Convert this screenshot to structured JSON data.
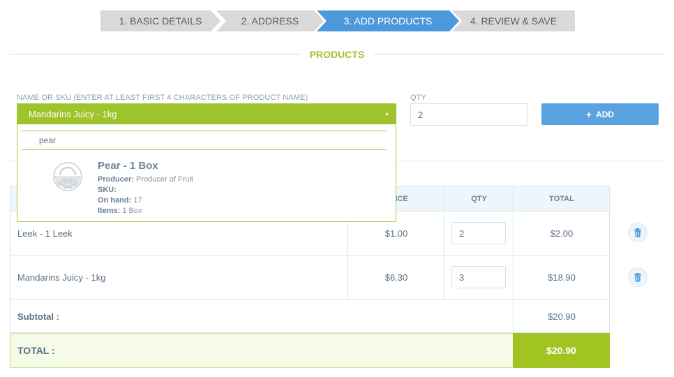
{
  "steps": [
    {
      "label": "1. BASIC DETAILS"
    },
    {
      "label": "2. ADDRESS"
    },
    {
      "label": "3. ADD PRODUCTS"
    },
    {
      "label": "4. REVIEW & SAVE"
    }
  ],
  "active_step": 3,
  "section": {
    "title": "PRODUCTS"
  },
  "form": {
    "name_label": "NAME OR SKU (ENTER AT LEAST FIRST 4 CHARACTERS OF PRODUCT NAME)",
    "qty_label": "QTY",
    "qty_value": "2",
    "add_label": "ADD"
  },
  "dropdown": {
    "selected": "Mandarins Juicy - 1kg",
    "search_value": "pear",
    "result": {
      "title": "Pear - 1 Box",
      "producer_label": "Producer:",
      "producer": "Producer of Fruit",
      "sku_label": "SKU:",
      "sku": "",
      "on_hand_label": "On hand:",
      "on_hand": "17",
      "items_label": "Items:",
      "items": "1 Box"
    }
  },
  "table": {
    "headers": {
      "price": "PRICE",
      "qty": "QTY",
      "total": "TOTAL"
    },
    "rows": [
      {
        "name": "Leek - 1 Leek",
        "price": "$1.00",
        "qty": "2",
        "total": "$2.00"
      },
      {
        "name": "Mandarins Juicy - 1kg",
        "price": "$6.30",
        "qty": "3",
        "total": "$18.90"
      }
    ],
    "subtotal_label": "Subtotal :",
    "subtotal": "$20.90",
    "total_label": "TOTAL :",
    "total": "$20.90"
  },
  "colors": {
    "accent_green": "#9fc32a",
    "active_step_blue": "#4b98dc",
    "button_blue": "#5aa3e0"
  },
  "icons": {
    "delete": "trash-icon",
    "add": "plus-icon",
    "caret": "caret-up-icon",
    "product": "fruit-basket-icon"
  }
}
